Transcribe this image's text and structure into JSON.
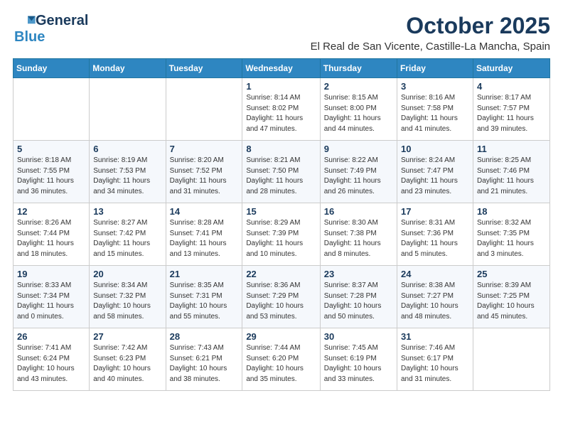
{
  "header": {
    "logo_general": "General",
    "logo_blue": "Blue",
    "month": "October 2025",
    "location": "El Real de San Vicente, Castille-La Mancha, Spain"
  },
  "weekdays": [
    "Sunday",
    "Monday",
    "Tuesday",
    "Wednesday",
    "Thursday",
    "Friday",
    "Saturday"
  ],
  "weeks": [
    [
      {
        "day": "",
        "info": ""
      },
      {
        "day": "",
        "info": ""
      },
      {
        "day": "",
        "info": ""
      },
      {
        "day": "1",
        "info": "Sunrise: 8:14 AM\nSunset: 8:02 PM\nDaylight: 11 hours\nand 47 minutes."
      },
      {
        "day": "2",
        "info": "Sunrise: 8:15 AM\nSunset: 8:00 PM\nDaylight: 11 hours\nand 44 minutes."
      },
      {
        "day": "3",
        "info": "Sunrise: 8:16 AM\nSunset: 7:58 PM\nDaylight: 11 hours\nand 41 minutes."
      },
      {
        "day": "4",
        "info": "Sunrise: 8:17 AM\nSunset: 7:57 PM\nDaylight: 11 hours\nand 39 minutes."
      }
    ],
    [
      {
        "day": "5",
        "info": "Sunrise: 8:18 AM\nSunset: 7:55 PM\nDaylight: 11 hours\nand 36 minutes."
      },
      {
        "day": "6",
        "info": "Sunrise: 8:19 AM\nSunset: 7:53 PM\nDaylight: 11 hours\nand 34 minutes."
      },
      {
        "day": "7",
        "info": "Sunrise: 8:20 AM\nSunset: 7:52 PM\nDaylight: 11 hours\nand 31 minutes."
      },
      {
        "day": "8",
        "info": "Sunrise: 8:21 AM\nSunset: 7:50 PM\nDaylight: 11 hours\nand 28 minutes."
      },
      {
        "day": "9",
        "info": "Sunrise: 8:22 AM\nSunset: 7:49 PM\nDaylight: 11 hours\nand 26 minutes."
      },
      {
        "day": "10",
        "info": "Sunrise: 8:24 AM\nSunset: 7:47 PM\nDaylight: 11 hours\nand 23 minutes."
      },
      {
        "day": "11",
        "info": "Sunrise: 8:25 AM\nSunset: 7:46 PM\nDaylight: 11 hours\nand 21 minutes."
      }
    ],
    [
      {
        "day": "12",
        "info": "Sunrise: 8:26 AM\nSunset: 7:44 PM\nDaylight: 11 hours\nand 18 minutes."
      },
      {
        "day": "13",
        "info": "Sunrise: 8:27 AM\nSunset: 7:42 PM\nDaylight: 11 hours\nand 15 minutes."
      },
      {
        "day": "14",
        "info": "Sunrise: 8:28 AM\nSunset: 7:41 PM\nDaylight: 11 hours\nand 13 minutes."
      },
      {
        "day": "15",
        "info": "Sunrise: 8:29 AM\nSunset: 7:39 PM\nDaylight: 11 hours\nand 10 minutes."
      },
      {
        "day": "16",
        "info": "Sunrise: 8:30 AM\nSunset: 7:38 PM\nDaylight: 11 hours\nand 8 minutes."
      },
      {
        "day": "17",
        "info": "Sunrise: 8:31 AM\nSunset: 7:36 PM\nDaylight: 11 hours\nand 5 minutes."
      },
      {
        "day": "18",
        "info": "Sunrise: 8:32 AM\nSunset: 7:35 PM\nDaylight: 11 hours\nand 3 minutes."
      }
    ],
    [
      {
        "day": "19",
        "info": "Sunrise: 8:33 AM\nSunset: 7:34 PM\nDaylight: 11 hours\nand 0 minutes."
      },
      {
        "day": "20",
        "info": "Sunrise: 8:34 AM\nSunset: 7:32 PM\nDaylight: 10 hours\nand 58 minutes."
      },
      {
        "day": "21",
        "info": "Sunrise: 8:35 AM\nSunset: 7:31 PM\nDaylight: 10 hours\nand 55 minutes."
      },
      {
        "day": "22",
        "info": "Sunrise: 8:36 AM\nSunset: 7:29 PM\nDaylight: 10 hours\nand 53 minutes."
      },
      {
        "day": "23",
        "info": "Sunrise: 8:37 AM\nSunset: 7:28 PM\nDaylight: 10 hours\nand 50 minutes."
      },
      {
        "day": "24",
        "info": "Sunrise: 8:38 AM\nSunset: 7:27 PM\nDaylight: 10 hours\nand 48 minutes."
      },
      {
        "day": "25",
        "info": "Sunrise: 8:39 AM\nSunset: 7:25 PM\nDaylight: 10 hours\nand 45 minutes."
      }
    ],
    [
      {
        "day": "26",
        "info": "Sunrise: 7:41 AM\nSunset: 6:24 PM\nDaylight: 10 hours\nand 43 minutes."
      },
      {
        "day": "27",
        "info": "Sunrise: 7:42 AM\nSunset: 6:23 PM\nDaylight: 10 hours\nand 40 minutes."
      },
      {
        "day": "28",
        "info": "Sunrise: 7:43 AM\nSunset: 6:21 PM\nDaylight: 10 hours\nand 38 minutes."
      },
      {
        "day": "29",
        "info": "Sunrise: 7:44 AM\nSunset: 6:20 PM\nDaylight: 10 hours\nand 35 minutes."
      },
      {
        "day": "30",
        "info": "Sunrise: 7:45 AM\nSunset: 6:19 PM\nDaylight: 10 hours\nand 33 minutes."
      },
      {
        "day": "31",
        "info": "Sunrise: 7:46 AM\nSunset: 6:17 PM\nDaylight: 10 hours\nand 31 minutes."
      },
      {
        "day": "",
        "info": ""
      }
    ]
  ]
}
